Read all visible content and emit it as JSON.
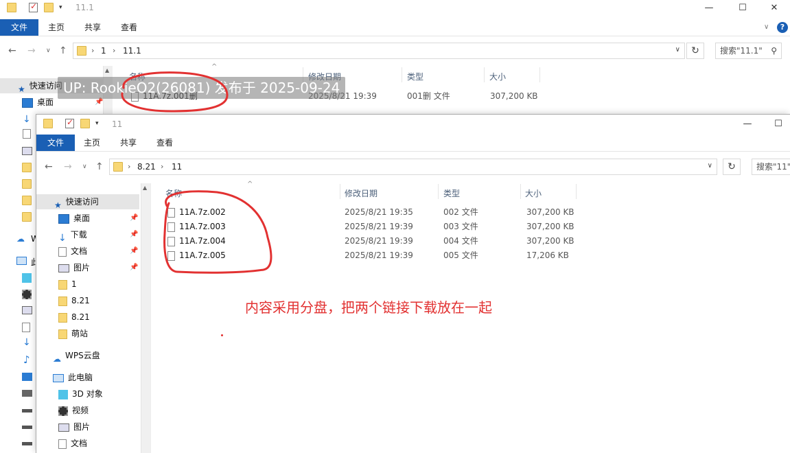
{
  "back_window": {
    "title": "11.1",
    "ribbon_tabs": [
      "文件",
      "主页",
      "共享",
      "查看"
    ],
    "breadcrumb": [
      "1",
      "11.1"
    ],
    "search_placeholder": "搜索\"11.1\"",
    "columns": {
      "name": "名称",
      "date": "修改日期",
      "type": "类型",
      "size": "大小"
    },
    "files": [
      {
        "name": "11A.7z.001删",
        "date": "2025/8/21 19:39",
        "type": "001删 文件",
        "size": "307,200 KB"
      }
    ],
    "sidebar": {
      "quick_access": "快速访问",
      "desktop": "桌面",
      "wps_partial": "W",
      "pc_partial": "此"
    }
  },
  "front_window": {
    "title": "11",
    "ribbon_tabs": [
      "文件",
      "主页",
      "共享",
      "查看"
    ],
    "breadcrumb": [
      "8.21",
      "11"
    ],
    "search_placeholder": "搜索\"11\"",
    "columns": {
      "name": "名称",
      "date": "修改日期",
      "type": "类型",
      "size": "大小"
    },
    "files": [
      {
        "name": "11A.7z.002",
        "date": "2025/8/21 19:35",
        "type": "002 文件",
        "size": "307,200 KB"
      },
      {
        "name": "11A.7z.003",
        "date": "2025/8/21 19:39",
        "type": "003 文件",
        "size": "307,200 KB"
      },
      {
        "name": "11A.7z.004",
        "date": "2025/8/21 19:39",
        "type": "004 文件",
        "size": "307,200 KB"
      },
      {
        "name": "11A.7z.005",
        "date": "2025/8/21 19:39",
        "type": "005 文件",
        "size": "17,206 KB"
      }
    ],
    "sidebar": [
      {
        "label": "快速访问",
        "icon": "star-icon"
      },
      {
        "label": "桌面",
        "icon": "desktop-icon",
        "pinned": true
      },
      {
        "label": "下载",
        "icon": "download-icon",
        "pinned": true
      },
      {
        "label": "文档",
        "icon": "document-icon",
        "pinned": true
      },
      {
        "label": "图片",
        "icon": "picture-icon",
        "pinned": true
      },
      {
        "label": "1",
        "icon": "folder-icon"
      },
      {
        "label": "8.21",
        "icon": "folder-icon"
      },
      {
        "label": "8.21",
        "icon": "folder-icon"
      },
      {
        "label": "萌站",
        "icon": "folder-icon"
      },
      {
        "label": "WPS云盘",
        "icon": "cloud-icon"
      },
      {
        "label": "此电脑",
        "icon": "computer-icon"
      },
      {
        "label": "3D 对象",
        "icon": "cube-icon"
      },
      {
        "label": "视频",
        "icon": "video-icon"
      },
      {
        "label": "图片",
        "icon": "picture-icon"
      },
      {
        "label": "文档",
        "icon": "document-icon"
      }
    ]
  },
  "watermark": "UP: RookieO2(26081) 发布于 2025-09-24",
  "annotation": "内容采用分盘，把两个链接下载放在一起",
  "colors": {
    "accent": "#1a5fb4",
    "annotation_red": "#e23131",
    "folder": "#f8d775"
  }
}
